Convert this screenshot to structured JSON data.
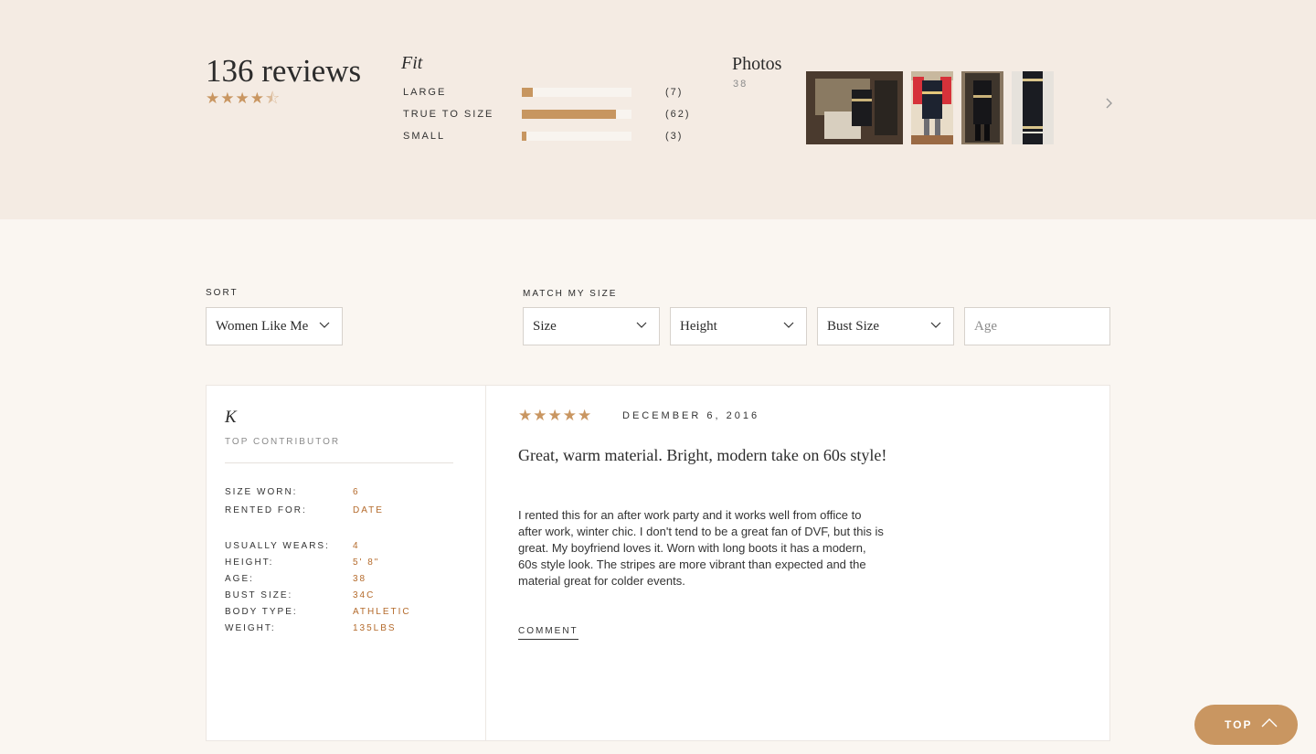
{
  "summary": {
    "review_count": "136 reviews",
    "rating_value": 4.5,
    "rating_max": 5,
    "fit": {
      "title": "Fit",
      "rows": [
        {
          "label": "LARGE",
          "count": "(7)",
          "value": 7
        },
        {
          "label": "TRUE TO SIZE",
          "count": "(62)",
          "value": 62
        },
        {
          "label": "SMALL",
          "count": "(3)",
          "value": 3
        }
      ]
    },
    "photos": {
      "title": "Photos",
      "count": "38"
    }
  },
  "filters": {
    "sort_label": "SORT",
    "sort_value": "Women Like Me",
    "match_label": "MATCH MY SIZE",
    "size": "Size",
    "height": "Height",
    "bust_size": "Bust Size",
    "age_placeholder": "Age"
  },
  "review": {
    "reviewer": "K",
    "badge": "TOP CONTRIBUTOR",
    "specs": [
      {
        "label": "SIZE WORN:",
        "value": "6"
      },
      {
        "label": "RENTED FOR:",
        "value": "DATE"
      },
      {
        "label": "USUALLY WEARS:",
        "value": "4"
      },
      {
        "label": "HEIGHT:",
        "value": "5' 8\""
      },
      {
        "label": "AGE:",
        "value": "38"
      },
      {
        "label": "BUST SIZE:",
        "value": "34C"
      },
      {
        "label": "BODY TYPE:",
        "value": "ATHLETIC"
      },
      {
        "label": "WEIGHT:",
        "value": "135LBS"
      }
    ],
    "stars": "★★★★★",
    "date": "DECEMBER 6, 2016",
    "title": "Great, warm material. Bright, modern take on 60s style!",
    "body": "I rented this for an after work party and it works well from office to after work, winter chic. I don't tend to be a great fan of DVF, but this is great. My boyfriend loves it. Worn with long boots it has a modern, 60s style look. The stripes are more vibrant than expected and the material great for colder events.",
    "comment": "COMMENT"
  },
  "top_button": "TOP",
  "colors": {
    "accent": "#c99661",
    "header_bg": "#f4ebe3",
    "page_bg": "#faf6f1",
    "spec_value": "#b46a2b"
  }
}
